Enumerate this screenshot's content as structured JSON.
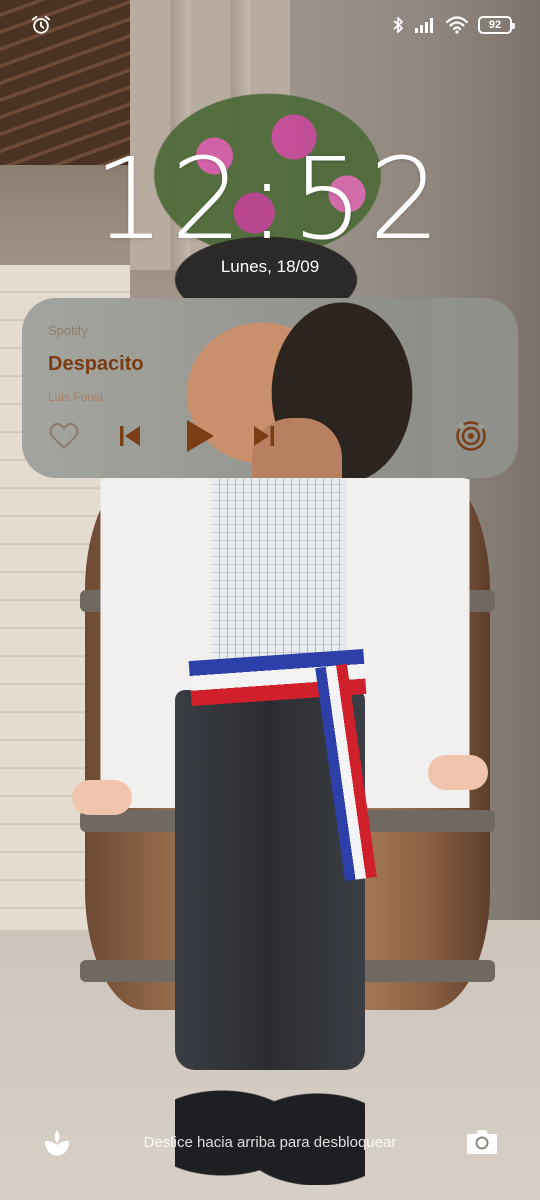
{
  "status_bar": {
    "battery_level": "92",
    "icons": [
      "alarm-icon",
      "bluetooth-icon",
      "signal-icon",
      "wifi-icon",
      "battery-icon"
    ]
  },
  "lock_screen": {
    "time": "12:52",
    "date": "Lunes, 18/09",
    "unlock_hint": "Deslice hacia arriba para desbloquear"
  },
  "media_player": {
    "app_name": "Spotify",
    "track_title": "Despacito",
    "artist": "Luis Fonsi",
    "controls": [
      "heart-icon",
      "previous-icon",
      "play-icon",
      "next-icon",
      "cast-icon"
    ],
    "accent_color": "#7b3d14"
  },
  "shortcuts": {
    "left": "leaf-icon",
    "right": "camera-icon"
  }
}
